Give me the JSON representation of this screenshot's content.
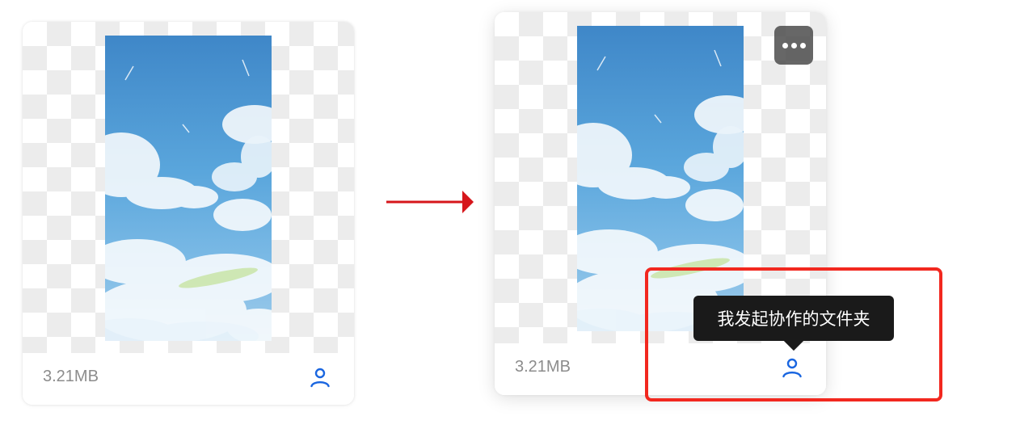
{
  "cards": [
    {
      "file_size": "3.21MB",
      "image": "sky-clouds-image",
      "owner_icon": "user-icon",
      "state": "default"
    },
    {
      "file_size": "3.21MB",
      "image": "sky-clouds-image",
      "owner_icon": "user-icon",
      "more_button_icon": "more-horizontal-icon",
      "state": "hover"
    }
  ],
  "tooltip": {
    "text": "我发起协作的文件夹"
  },
  "colors": {
    "accent_icon": "#1a66e0",
    "annotation_red": "#f2281f",
    "arrow_red": "#d6161b",
    "tooltip_bg": "#1a1a1a",
    "size_text": "#8c8c8c"
  },
  "annotations": {
    "transition_arrow": "arrow-right",
    "highlight_box": "red-outline"
  }
}
